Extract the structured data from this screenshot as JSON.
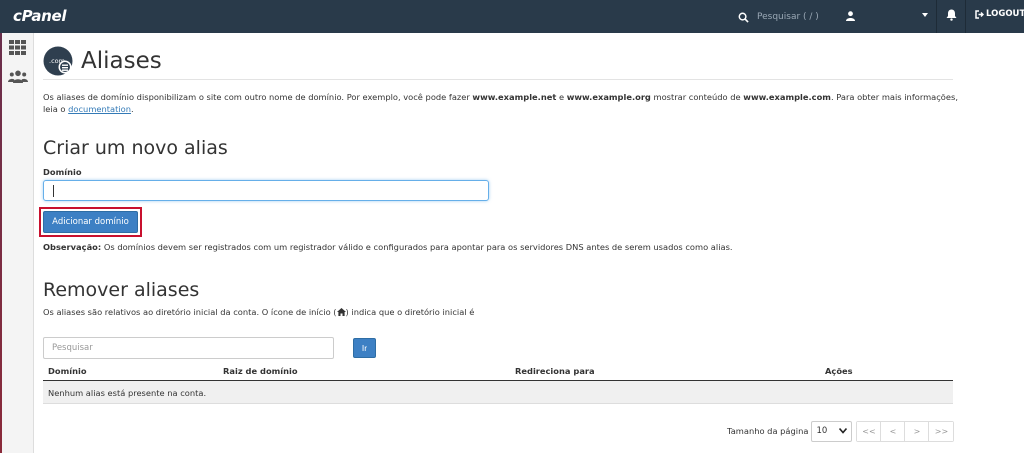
{
  "topbar": {
    "logo": "cPanel",
    "search_placeholder": "Pesquisar ( / )",
    "logout_label": "LOGOUT",
    "icons": [
      "search-icon",
      "user-icon",
      "caret-down-icon",
      "bell-icon",
      "logout-icon"
    ]
  },
  "sidebar": {
    "icons": [
      "grid-icon",
      "users-icon"
    ]
  },
  "page": {
    "title": "Aliases",
    "title_icon": "com-domain-icon",
    "description_start": "Os aliases de domínio disponibilizam o site com outro nome de domínio. Por exemplo, você pode fazer ",
    "example_net": "www.example.net",
    "desc_and": " e ",
    "example_org": "www.example.org",
    "desc_middle": " mostrar conteúdo de ",
    "example_com": "www.example.com",
    "desc_end": ". Para obter mais informações, leia o ",
    "doc_link": "documentation",
    "desc_period": "."
  },
  "create": {
    "heading": "Criar um novo alias",
    "domain_label": "Domínio",
    "domain_value": "",
    "add_button": "Adicionar domínio",
    "note_label": "Observação:",
    "note_text": " Os domínios devem ser registrados com um registrador válido e configurados para apontar para os servidores DNS antes de serem usados como alias."
  },
  "remove": {
    "heading": "Remover aliases",
    "info_start": "Os aliases são relativos ao diretório inicial da conta. O ícone de início (",
    "info_end": ") indica que o diretório inicial é",
    "search_placeholder": "Pesquisar",
    "go_button": "Ir",
    "columns": [
      "Domínio",
      "Raiz de domínio",
      "Redireciona para",
      "Ações"
    ],
    "empty_message": "Nenhum alias está presente na conta."
  },
  "pager": {
    "label": "Tamanho da página",
    "page_size": "10",
    "first": "<<",
    "prev": "<",
    "next": ">",
    "last": ">>"
  },
  "colors": {
    "topbar": "#293a4a",
    "primary_button": "#3d80c4",
    "highlight": "#c8102e"
  }
}
